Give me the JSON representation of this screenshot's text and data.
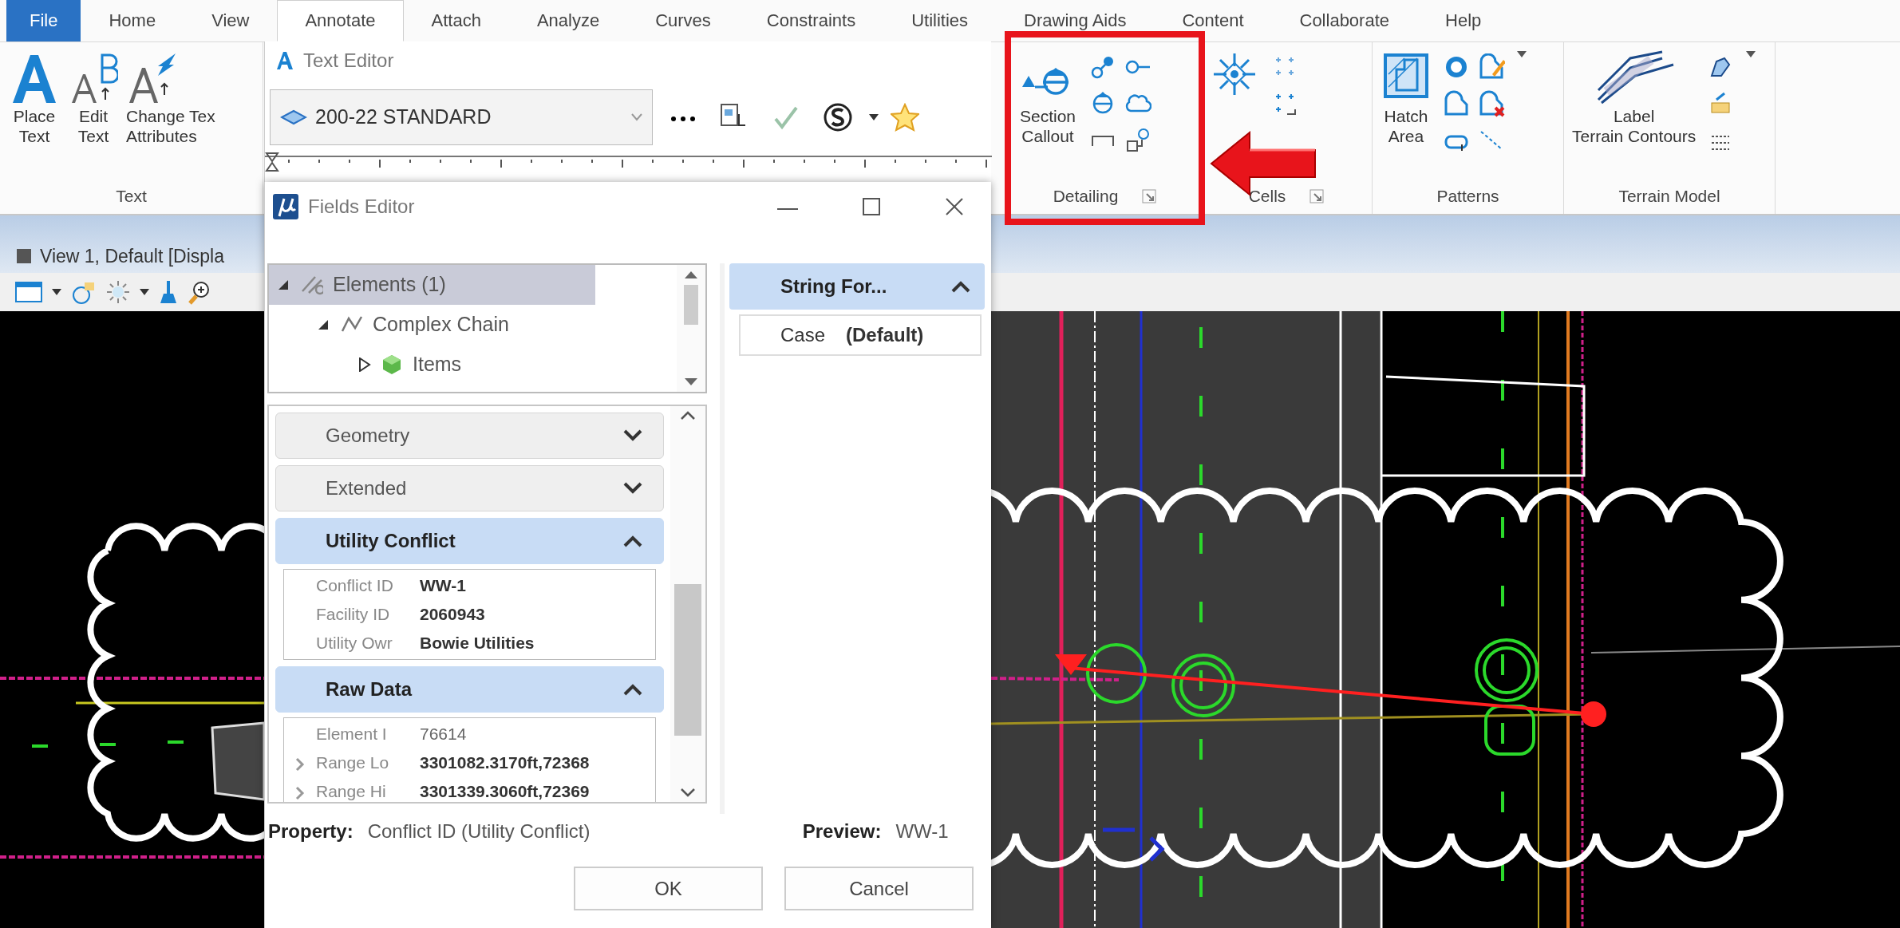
{
  "ribbon_tabs": [
    {
      "label": "File",
      "kind": "backstage",
      "selected": false
    },
    {
      "label": "Home",
      "kind": "tab",
      "selected": false
    },
    {
      "label": "View",
      "kind": "tab",
      "selected": false
    },
    {
      "label": "Annotate",
      "kind": "tab",
      "selected": true
    },
    {
      "label": "Attach",
      "kind": "tab",
      "selected": false
    },
    {
      "label": "Analyze",
      "kind": "tab",
      "selected": false
    },
    {
      "label": "Curves",
      "kind": "tab",
      "selected": false
    },
    {
      "label": "Constraints",
      "kind": "tab",
      "selected": false
    },
    {
      "label": "Utilities",
      "kind": "tab",
      "selected": false
    },
    {
      "label": "Drawing Aids",
      "kind": "tab",
      "selected": false
    },
    {
      "label": "Content",
      "kind": "tab",
      "selected": false
    },
    {
      "label": "Collaborate",
      "kind": "tab",
      "selected": false
    },
    {
      "label": "Help",
      "kind": "tab",
      "selected": false
    }
  ],
  "ribbon_groups": [
    {
      "title": "Text",
      "buttons": [
        {
          "lines": [
            "Place",
            "Text"
          ]
        },
        {
          "lines": [
            "Edit",
            "Text"
          ]
        },
        {
          "lines": [
            "Change Tex",
            "Attributes"
          ]
        }
      ]
    },
    {
      "title": "Detailing",
      "highlighted": true,
      "launcher": true,
      "buttons": [
        {
          "lines": [
            "Section",
            "Callout"
          ]
        }
      ]
    },
    {
      "title": "Cells",
      "launcher": true
    },
    {
      "title": "Patterns",
      "buttons": [
        {
          "lines": [
            "Hatch",
            "Area"
          ]
        }
      ]
    },
    {
      "title": "Terrain Model",
      "buttons": [
        {
          "lines": [
            "Label",
            "Terrain Contours"
          ]
        }
      ]
    }
  ],
  "view": {
    "title": "View 1, Default [Displa"
  },
  "text_editor": {
    "title": "Text Editor",
    "text_style": "200-22 STANDARD"
  },
  "fields_editor": {
    "title": "Fields Editor",
    "tree": [
      {
        "label": "Elements (1)",
        "selected": true,
        "expanded": true,
        "children": [
          {
            "label": "Complex Chain",
            "selected": false,
            "expanded": true,
            "children": [
              {
                "label": "Items",
                "selected": false,
                "expanded": false
              }
            ]
          }
        ]
      }
    ],
    "sections": [
      {
        "title": "Geometry",
        "expanded": false
      },
      {
        "title": "Extended",
        "expanded": false
      },
      {
        "title": "Utility Conflict",
        "expanded": true,
        "rows": [
          {
            "name": "Conflict ID",
            "value": "WW-1",
            "bold": true
          },
          {
            "name": "Facility ID",
            "value": "2060943",
            "bold": true
          },
          {
            "name": "Utility Owr",
            "value": "Bowie Utilities",
            "bold": true
          }
        ]
      },
      {
        "title": "Raw Data",
        "expanded": true,
        "rows": [
          {
            "name": "Element I",
            "value": "76614",
            "bold": false
          },
          {
            "name": "Range Lo",
            "value": "3301082.3170ft,72368",
            "bold": true,
            "expandable": true
          },
          {
            "name": "Range Hi",
            "value": "3301339.3060ft,72369",
            "bold": true,
            "expandable": true
          }
        ]
      }
    ],
    "format_panel": {
      "title": "String For...",
      "expanded": true,
      "rows": [
        {
          "name": "Case",
          "value": "(Default)"
        }
      ]
    },
    "property_label": "Property:",
    "property": "Conflict ID (Utility Conflict)",
    "preview_label": "Preview:",
    "preview": "WW-1",
    "buttons": [
      "OK",
      "Cancel"
    ]
  }
}
